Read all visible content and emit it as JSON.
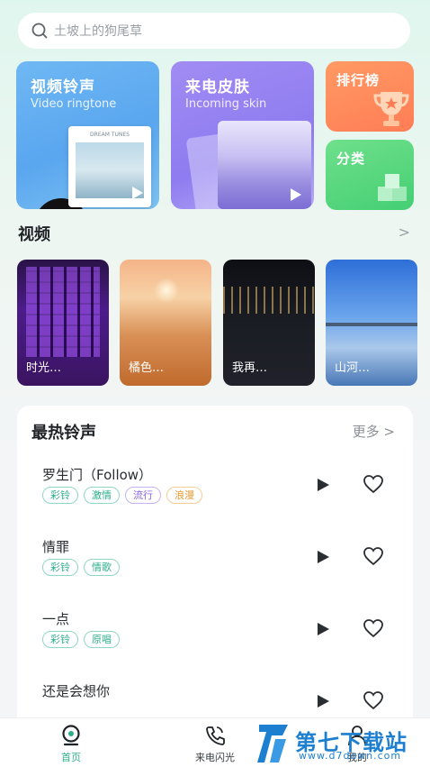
{
  "search": {
    "placeholder": "土坡上的狗尾草"
  },
  "features": {
    "ringtone": {
      "title": "视频铃声",
      "subtitle": "Video ringtone",
      "album_text": "DREAM TUNES"
    },
    "skin": {
      "title": "来电皮肤",
      "subtitle": "Incoming skin"
    },
    "rank": {
      "title": "排行榜"
    },
    "category": {
      "title": "分类"
    }
  },
  "video_section": {
    "title": "视频",
    "more": ">"
  },
  "videos": [
    {
      "label": "时光…"
    },
    {
      "label": "橘色…"
    },
    {
      "label": "我再…"
    },
    {
      "label": "山河…"
    }
  ],
  "hot": {
    "title": "最热铃声",
    "more": "更多 >",
    "items": [
      {
        "name": "罗生门（Follow）",
        "tags": [
          "彩铃",
          "激情",
          "流行",
          "浪漫"
        ]
      },
      {
        "name": "情罪",
        "tags": [
          "彩铃",
          "情歌"
        ]
      },
      {
        "name": "一点",
        "tags": [
          "彩铃",
          "原唱"
        ]
      },
      {
        "name": "还是会想你",
        "tags": []
      }
    ]
  },
  "nav": {
    "home": "首页",
    "flash": "来电闪光",
    "mine": "我的"
  },
  "watermark": {
    "title": "第七下载站",
    "url": "www.d7down.com"
  },
  "colors": {
    "accent": "#2fae8a",
    "brand_blue": "#1d7fd0"
  }
}
